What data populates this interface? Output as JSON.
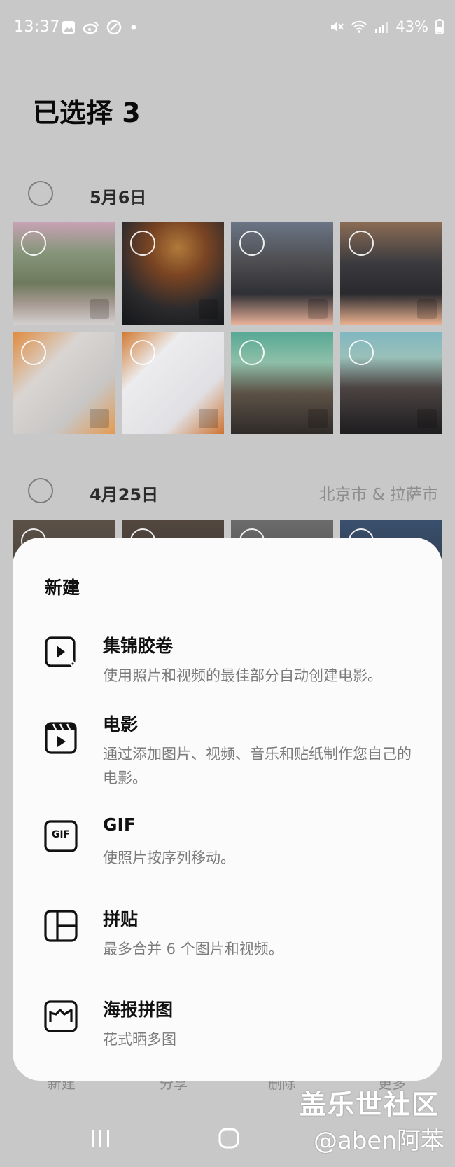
{
  "status_bar": {
    "time": "13:37",
    "battery": "43%",
    "icons_left": [
      "gallery-icon",
      "weibo-icon",
      "app-icon",
      "dot-icon"
    ],
    "icons_right": [
      "mute-icon",
      "wifi-icon",
      "signal-icon",
      "battery-icon"
    ]
  },
  "header": {
    "title": "已选择 3"
  },
  "groups": [
    {
      "date": "5月6日",
      "location": ""
    },
    {
      "date": "4月25日",
      "location": "北京市 & 拉萨市"
    }
  ],
  "sheet": {
    "title": "新建",
    "options": [
      {
        "title": "集锦胶卷",
        "desc": "使用照片和视频的最佳部分自动创建电影。",
        "icon": "highlight-reel-icon"
      },
      {
        "title": "电影",
        "desc": "通过添加图片、视频、音乐和贴纸制作您自己的电影。",
        "icon": "movie-icon"
      },
      {
        "title": "GIF",
        "desc": "使照片按序列移动。",
        "icon": "gif-icon",
        "icon_text": "GIF"
      },
      {
        "title": "拼贴",
        "desc": "最多合并 6 个图片和视频。",
        "icon": "collage-icon"
      },
      {
        "title": "海报拼图",
        "desc": "花式晒多图",
        "icon": "poster-icon"
      }
    ]
  },
  "bottom_bar": {
    "labels": [
      "新建",
      "分享",
      "删除",
      "更多"
    ]
  },
  "watermark": {
    "line1": "盖乐世社区",
    "line2": "@aben阿苯"
  },
  "colors": {
    "background": "#c8c8c8",
    "sheet": "#fbfbfb",
    "secondary_text": "#7b7b7b"
  }
}
